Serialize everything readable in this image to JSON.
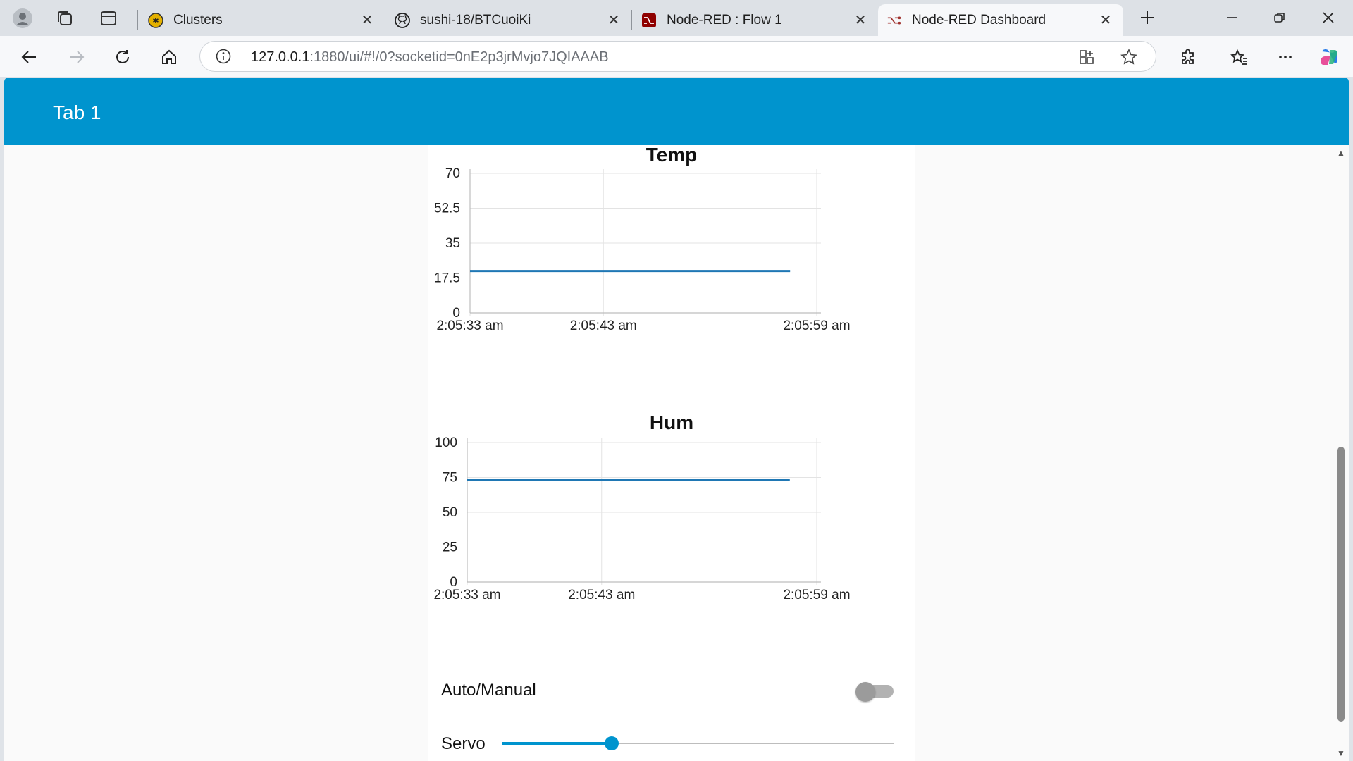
{
  "browser": {
    "tabs": [
      {
        "title": "Clusters",
        "icon": "cluster-logo-icon",
        "active": false
      },
      {
        "title": "sushi-18/BTCuoiKi",
        "icon": "github-icon",
        "active": false
      },
      {
        "title": "Node-RED : Flow 1",
        "icon": "node-red-icon",
        "active": false
      },
      {
        "title": "Node-RED Dashboard",
        "icon": "node-red-icon",
        "active": true
      }
    ],
    "url_host": "127.0.0.1",
    "url_rest": ":1880/ui/#!/0?socketid=0nE2p3jrMvjo7JQIAAAB"
  },
  "dashboard": {
    "tab_title": "Tab 1",
    "accent": "#0094ce"
  },
  "charts": [
    {
      "type": "line",
      "title": "Temp",
      "x_ticks": [
        "2:05:33 am",
        "2:05:43 am",
        "2:05:59 am"
      ],
      "y_ticks": [
        "70",
        "52.5",
        "35",
        "17.5",
        "0"
      ],
      "ylim": [
        0,
        70
      ],
      "series": [
        {
          "x": [
            "2:05:33 am",
            "2:05:57 am"
          ],
          "y": [
            21,
            21
          ]
        }
      ]
    },
    {
      "type": "line",
      "title": "Hum",
      "x_ticks": [
        "2:05:33 am",
        "2:05:43 am",
        "2:05:59 am"
      ],
      "y_ticks": [
        "100",
        "75",
        "50",
        "25",
        "0"
      ],
      "ylim": [
        0,
        100
      ],
      "series": [
        {
          "x": [
            "2:05:33 am",
            "2:05:57 am"
          ],
          "y": [
            73,
            73
          ]
        }
      ]
    }
  ],
  "chart_data": [
    {
      "type": "line",
      "title": "Temp",
      "x": [
        "2:05:33 am",
        "2:05:57 am"
      ],
      "series": [
        {
          "values": [
            21,
            21
          ]
        }
      ],
      "ylim": [
        0,
        70
      ],
      "grid": true
    },
    {
      "type": "line",
      "title": "Hum",
      "x": [
        "2:05:33 am",
        "2:05:57 am"
      ],
      "series": [
        {
          "values": [
            73,
            73
          ]
        }
      ],
      "ylim": [
        0,
        100
      ],
      "grid": true
    }
  ],
  "controls": {
    "switch_label": "Auto/Manual",
    "switch_on": false,
    "slider_label": "Servo",
    "slider_fraction": 0.28
  }
}
